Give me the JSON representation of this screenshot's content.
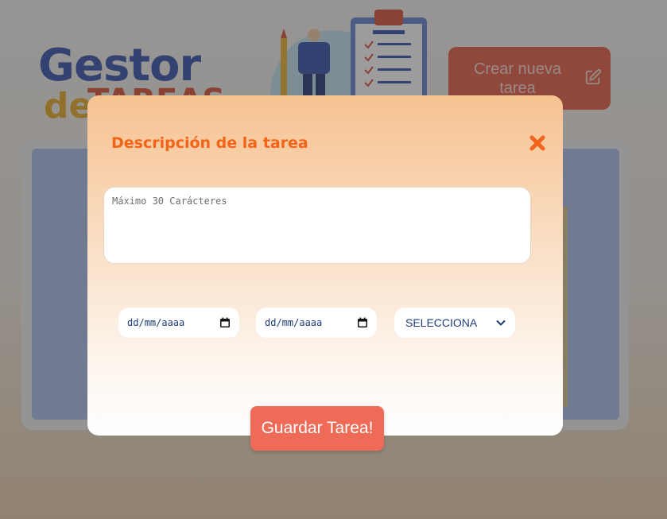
{
  "app": {
    "logo_line1": "Gestor",
    "logo_line2_a": "de",
    "logo_line2_b": "TAREAS",
    "create_button_label": "Crear nueva tarea"
  },
  "modal": {
    "title": "Descripción de la tarea",
    "description_placeholder": "Máximo 30 Carácteres",
    "start_date_placeholder": "dd/mm/aaaa",
    "end_date_placeholder": "dd/mm/aaaa",
    "priority_selected": "SELECCIONA",
    "save_button_label": "Guardar Tarea!"
  },
  "colors": {
    "accent": "#f26419",
    "button": "#ef6a57",
    "create_button": "#e8573e",
    "select_text": "#1d3c7a"
  },
  "icons": {
    "close": "close-icon",
    "edit": "edit-icon",
    "calendar": "calendar-icon",
    "chevron": "chevron-down-icon"
  }
}
